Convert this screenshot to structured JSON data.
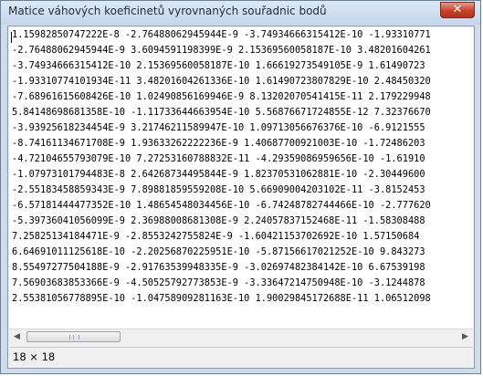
{
  "window": {
    "title": "Matice váhových koeficinetů vyrovnaných souřadnic bodů",
    "close_glyph": "✕"
  },
  "matrix": {
    "rows": [
      "1.15982850747222E-8 -2.76488062945944E-9 -3.74934666315412E-10 -1.93310771",
      "-2.76488062945944E-9 3.6094591198399E-9 2.15369560058187E-10 3.48201604261",
      "-3.74934666315412E-10 2.15369560058187E-10 1.66619273549105E-9 1.61490723",
      "-1.93310774101934E-11 3.48201604261336E-10 1.61490723807829E-10 2.48450320",
      "-7.68961615608426E-10 1.02490856169946E-9 8.13202070541415E-11 2.179229948",
      "5.84148698681358E-10 -1.11733644663954E-10 5.56876671724855E-12 7.32376670",
      "-3.93925618234454E-9 3.21746211589947E-10 1.09713056676376E-10 -6.9121555",
      "-8.74161134671708E-9 1.93633262222236E-9 1.40687700921003E-10 -1.72486203",
      "-4.72104655793079E-10 7.27253160788832E-11 -4.29359086959656E-10 -1.61910",
      "-1.07973101794483E-8 2.64268734495844E-9 1.82370531062881E-10 -2.30449600",
      "-2.55183458859343E-9 7.89881859559208E-10 5.66909004203102E-11 -3.8152453",
      "-6.57181444477352E-10 1.48654548034456E-10 -6.74248782744466E-10 -2.777620",
      "-5.39736041056099E-9 2.36988008681308E-9 2.24057837152468E-11 -1.58308488",
      "7.25825134184471E-9 -2.8553242755824E-9 -1.60421153702692E-10 1.57150684",
      "6.64691011125618E-10 -2.20256870225951E-10 -5.87156617021252E-10 9.843273",
      "8.55497277504188E-9 -2.91763539948335E-9 -3.02697482384142E-10 6.67539198",
      "7.56903683853366E-9 -4.50525792773853E-9 -3.33647214750948E-10 -3.1244878",
      "2.55381056778895E-10 -1.04758909281163E-10 1.90029845172688E-11 1.06512098"
    ]
  },
  "scrollbar": {
    "left_arrow": "◀",
    "right_arrow": "▶"
  },
  "status": {
    "dimensions": "18 × 18"
  }
}
